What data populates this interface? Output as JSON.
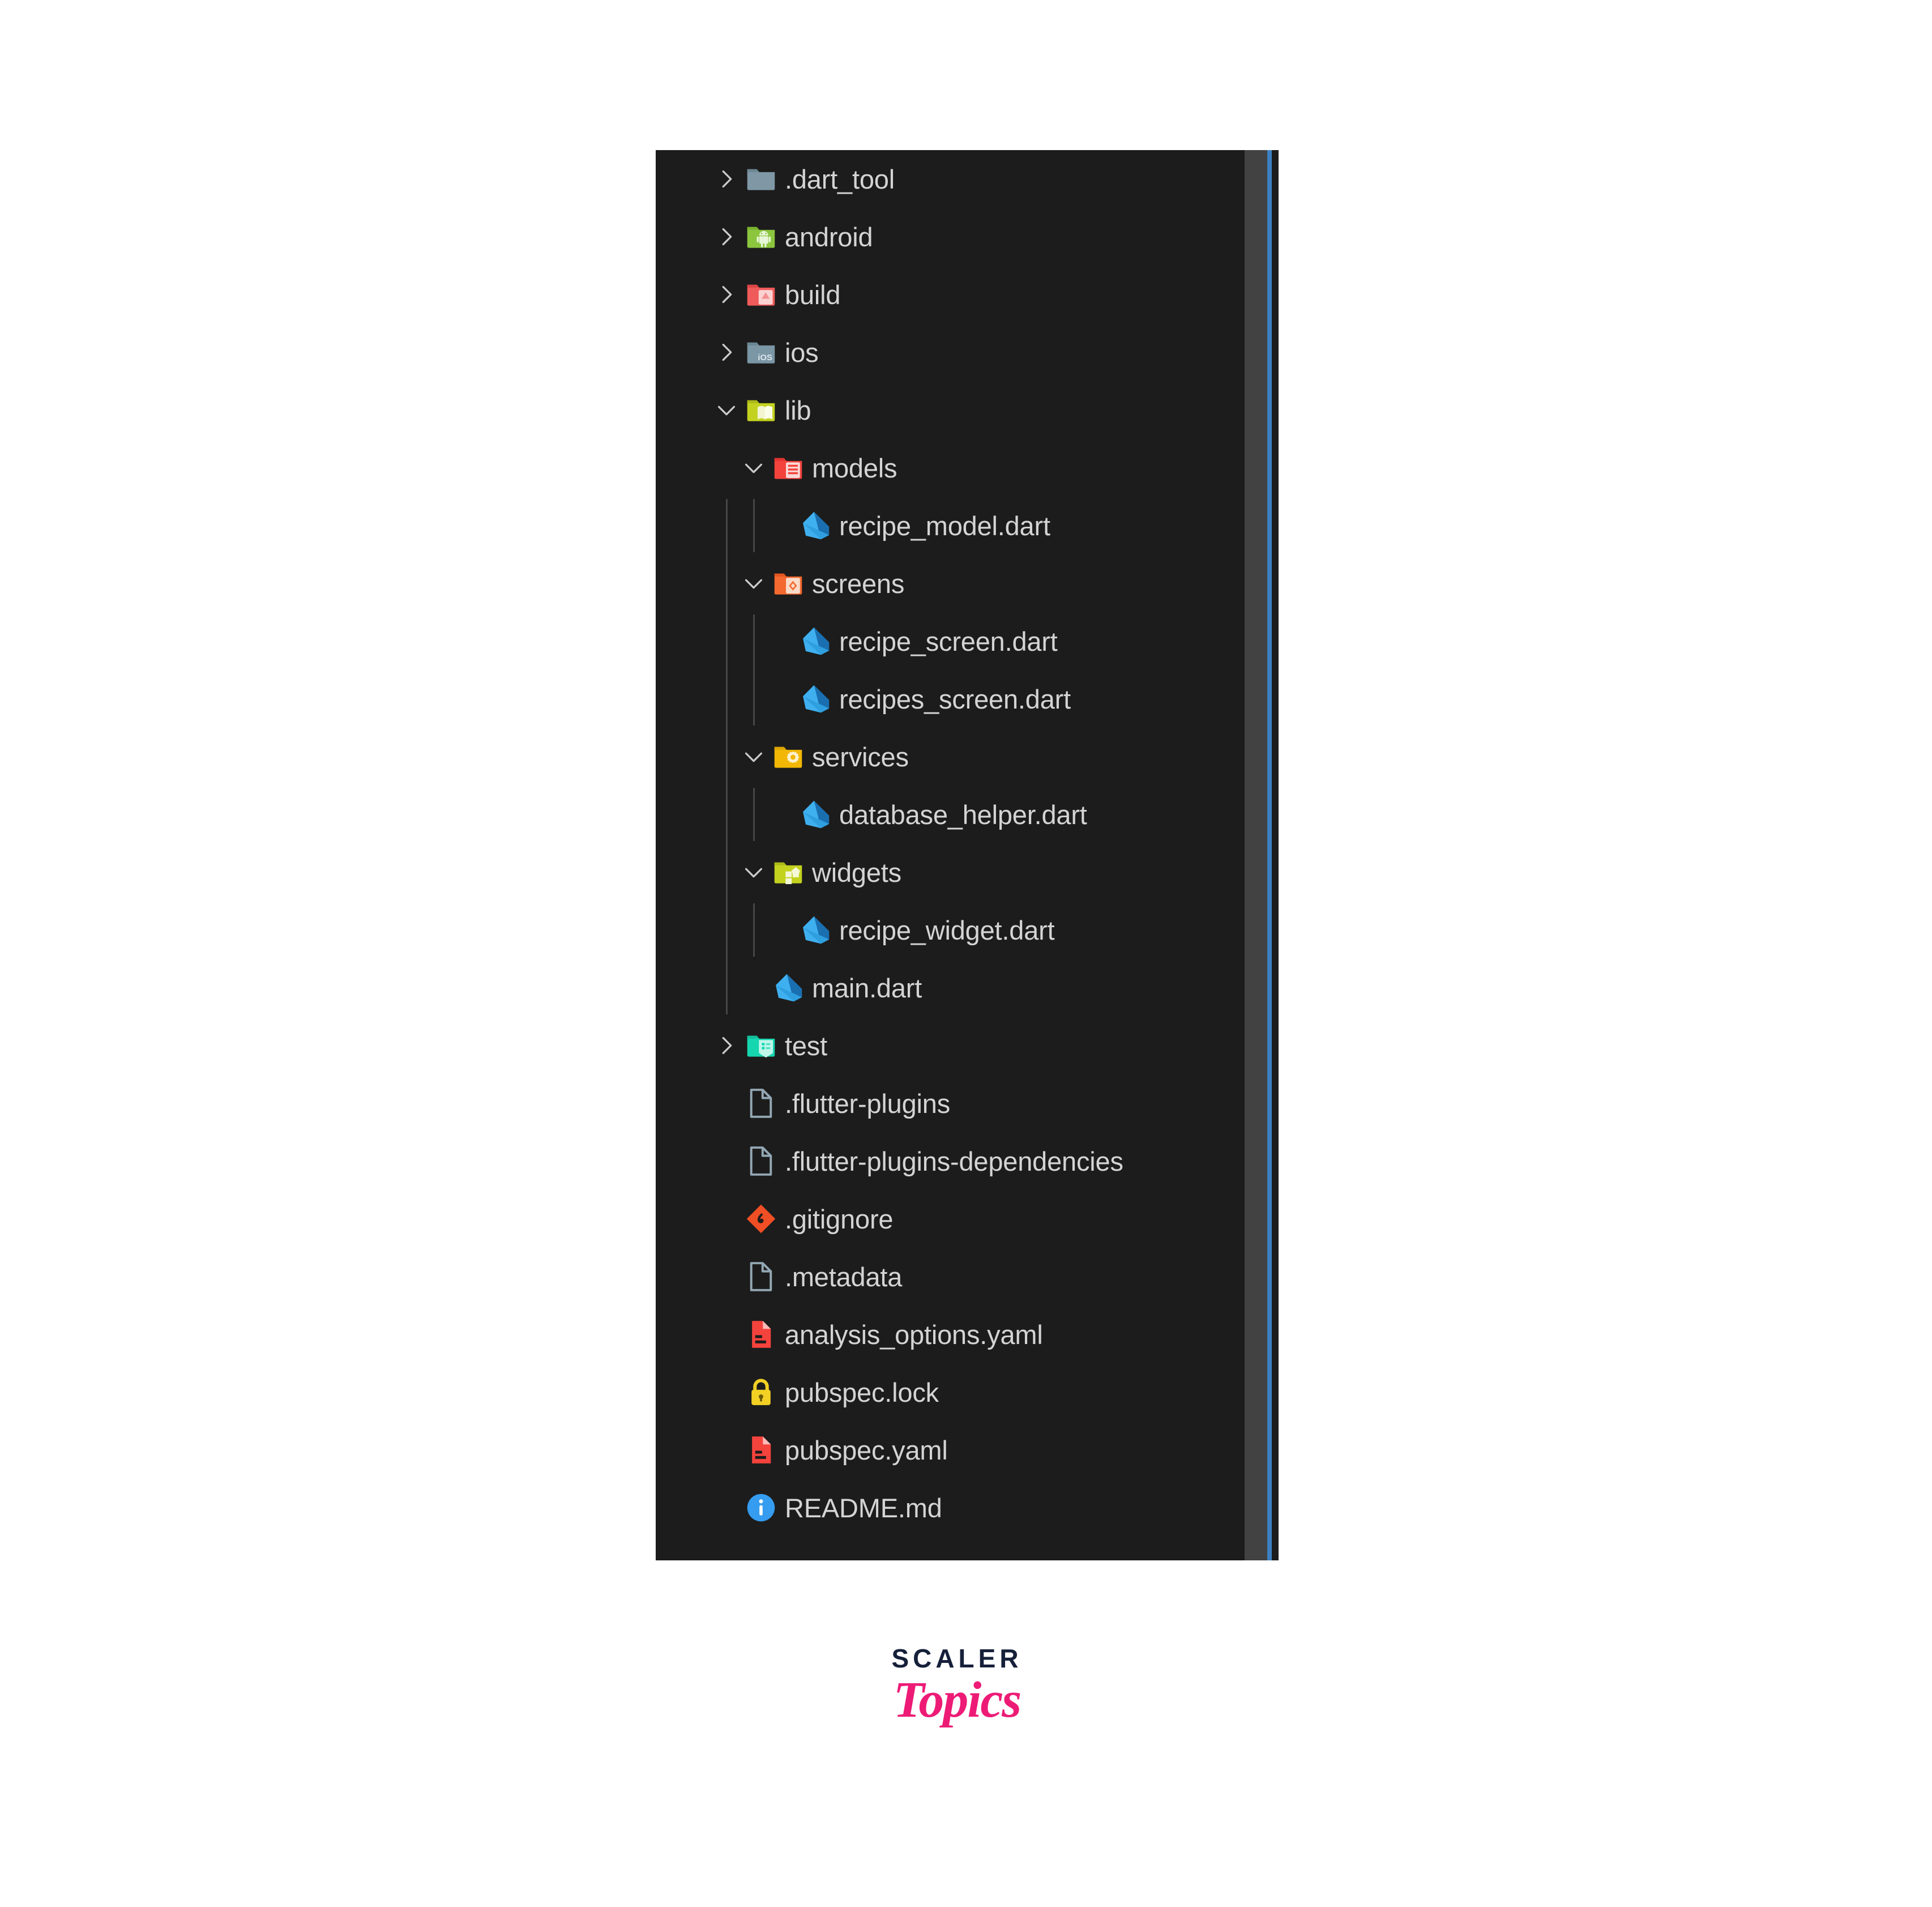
{
  "panel": {
    "background": "#1c1c1c",
    "text_color": "#d4d4d4",
    "indent_guide_color": "#464646",
    "scrollbar": {
      "thumb_color": "#424242",
      "accent_color": "#3d7fc1"
    }
  },
  "logo": {
    "primary": "SCALER",
    "secondary": "Topics",
    "primary_color": "#16203a",
    "secondary_color": "#ed1b76"
  },
  "tree": {
    "rows": [
      {
        "label": ".dart_tool",
        "depth": 0,
        "kind": "folder",
        "icon": "folder-dart-tool-icon",
        "expander": "collapsed",
        "color": "#8098a6"
      },
      {
        "label": "android",
        "depth": 0,
        "kind": "folder",
        "icon": "folder-android-icon",
        "expander": "collapsed",
        "color": "#8cc63f"
      },
      {
        "label": "build",
        "depth": 0,
        "kind": "folder",
        "icon": "folder-build-icon",
        "expander": "collapsed",
        "color": "#ef5a5a"
      },
      {
        "label": "ios",
        "depth": 0,
        "kind": "folder",
        "icon": "folder-ios-icon",
        "expander": "collapsed",
        "color": "#7b96a5"
      },
      {
        "label": "lib",
        "depth": 0,
        "kind": "folder",
        "icon": "folder-lib-icon",
        "expander": "expanded",
        "color": "#c3d21f"
      },
      {
        "label": "models",
        "depth": 1,
        "kind": "folder",
        "icon": "folder-models-icon",
        "expander": "expanded",
        "color": "#f4433c"
      },
      {
        "label": "recipe_model.dart",
        "depth": 2,
        "kind": "file",
        "icon": "dart-file-icon",
        "expander": "none",
        "color": "#2f9fe0"
      },
      {
        "label": "screens",
        "depth": 1,
        "kind": "folder",
        "icon": "folder-screens-icon",
        "expander": "expanded",
        "color": "#f4692f"
      },
      {
        "label": "recipe_screen.dart",
        "depth": 2,
        "kind": "file",
        "icon": "dart-file-icon",
        "expander": "none",
        "color": "#2f9fe0"
      },
      {
        "label": "recipes_screen.dart",
        "depth": 2,
        "kind": "file",
        "icon": "dart-file-icon",
        "expander": "none",
        "color": "#2f9fe0"
      },
      {
        "label": "services",
        "depth": 1,
        "kind": "folder",
        "icon": "folder-services-icon",
        "expander": "expanded",
        "color": "#f2b705"
      },
      {
        "label": "database_helper.dart",
        "depth": 2,
        "kind": "file",
        "icon": "dart-file-icon",
        "expander": "none",
        "color": "#2f9fe0"
      },
      {
        "label": "widgets",
        "depth": 1,
        "kind": "folder",
        "icon": "folder-widgets-icon",
        "expander": "expanded",
        "color": "#c3d21f"
      },
      {
        "label": "recipe_widget.dart",
        "depth": 2,
        "kind": "file",
        "icon": "dart-file-icon",
        "expander": "none",
        "color": "#2f9fe0"
      },
      {
        "label": "main.dart",
        "depth": 1,
        "kind": "file",
        "icon": "dart-file-icon",
        "expander": "none",
        "color": "#2f9fe0"
      },
      {
        "label": "test",
        "depth": 0,
        "kind": "folder",
        "icon": "folder-test-icon",
        "expander": "collapsed",
        "color": "#16d6b0"
      },
      {
        "label": ".flutter-plugins",
        "depth": 0,
        "kind": "file",
        "icon": "generic-file-icon",
        "expander": "none",
        "color": "#93a7b3"
      },
      {
        "label": ".flutter-plugins-dependencies",
        "depth": 0,
        "kind": "file",
        "icon": "generic-file-icon",
        "expander": "none",
        "color": "#93a7b3"
      },
      {
        "label": ".gitignore",
        "depth": 0,
        "kind": "file",
        "icon": "git-file-icon",
        "expander": "none",
        "color": "#f04e24"
      },
      {
        "label": ".metadata",
        "depth": 0,
        "kind": "file",
        "icon": "generic-file-icon",
        "expander": "none",
        "color": "#93a7b3"
      },
      {
        "label": "analysis_options.yaml",
        "depth": 0,
        "kind": "file",
        "icon": "yaml-file-icon",
        "expander": "none",
        "color": "#f4433c"
      },
      {
        "label": "pubspec.lock",
        "depth": 0,
        "kind": "file",
        "icon": "lock-file-icon",
        "expander": "none",
        "color": "#f2d024"
      },
      {
        "label": "pubspec.yaml",
        "depth": 0,
        "kind": "file",
        "icon": "yaml-file-icon",
        "expander": "none",
        "color": "#f4433c"
      },
      {
        "label": "README.md",
        "depth": 0,
        "kind": "file",
        "icon": "info-file-icon",
        "expander": "none",
        "color": "#359cf0"
      }
    ]
  }
}
